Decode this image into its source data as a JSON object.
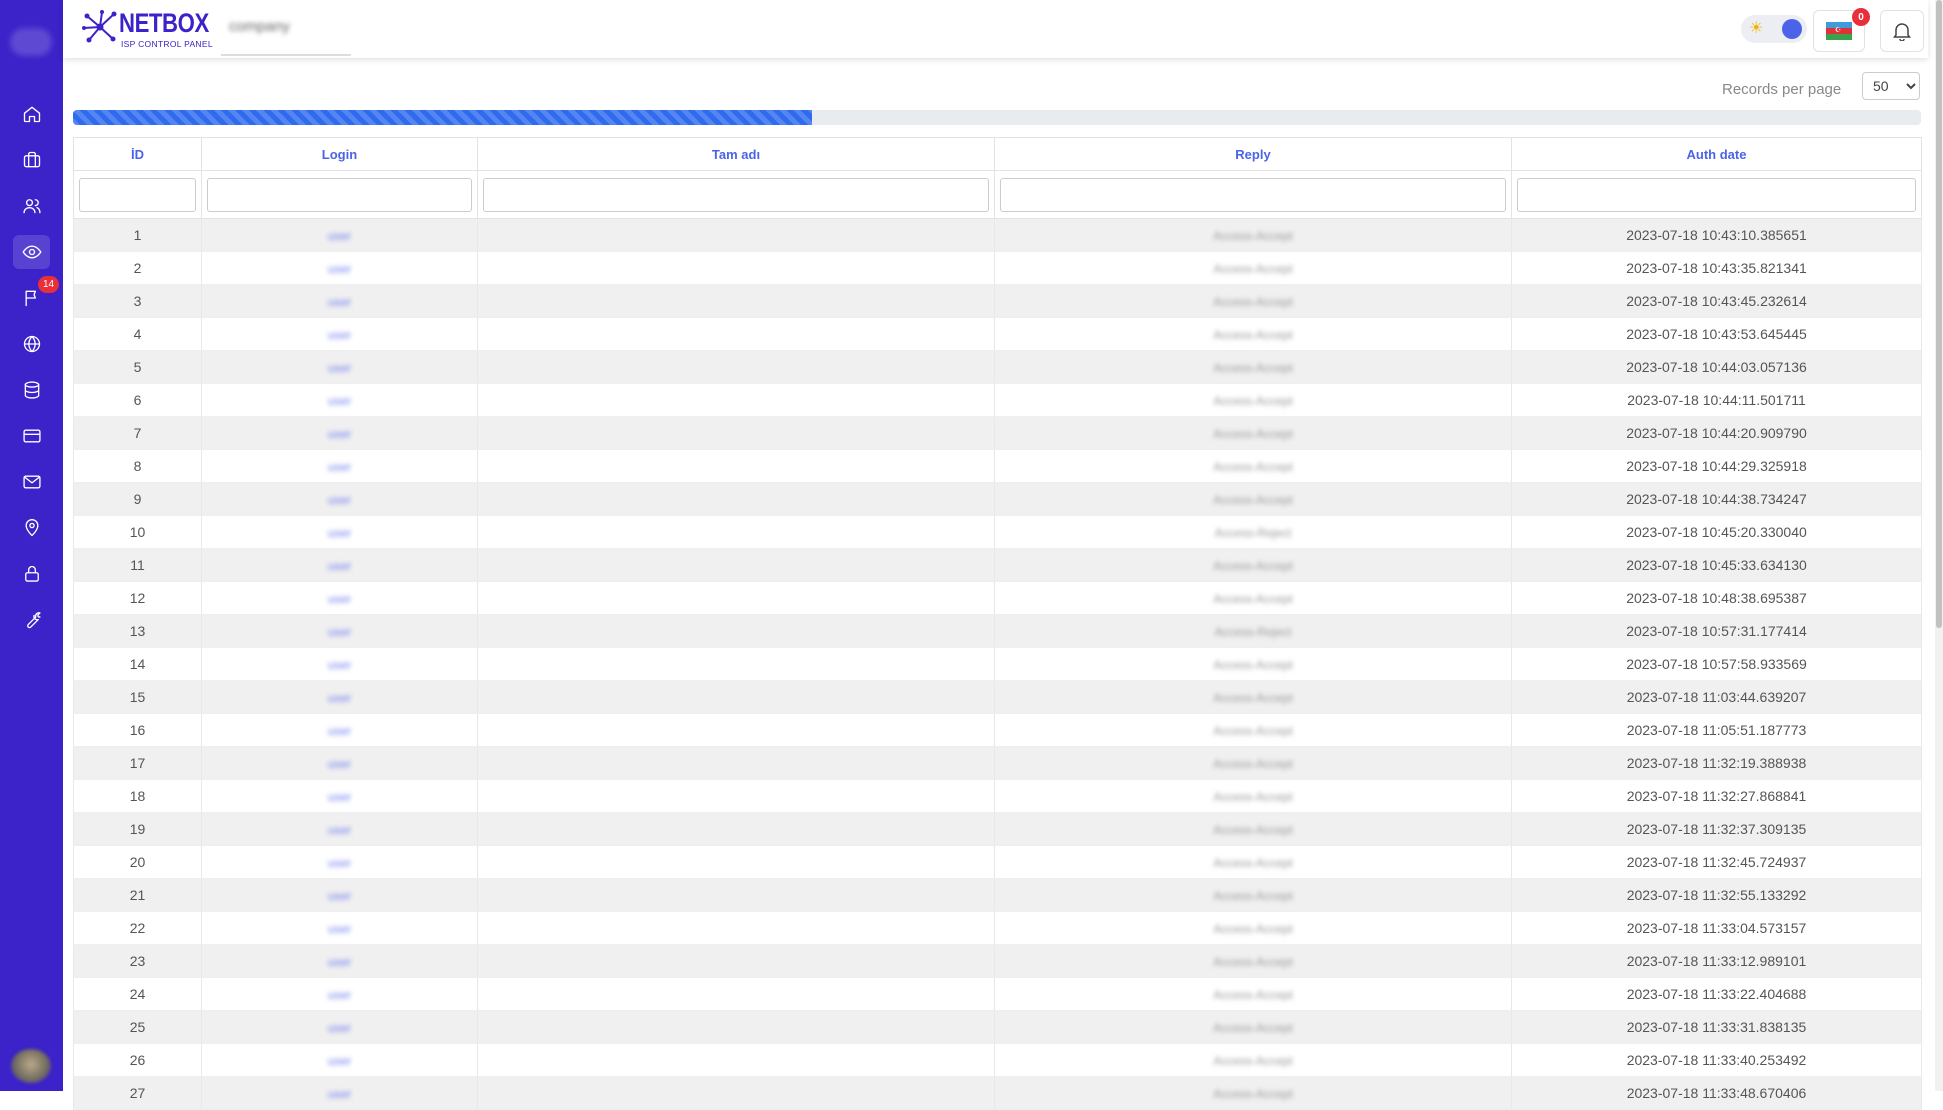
{
  "brand": {
    "name": "NETBOX",
    "subtitle": "ISP CONTROL PANEL"
  },
  "header": {
    "company_tab": "company",
    "notification_count": "0"
  },
  "sidebar": {
    "items": [
      {
        "icon": "home-icon"
      },
      {
        "icon": "briefcase-icon"
      },
      {
        "icon": "users-icon"
      },
      {
        "icon": "eye-icon",
        "active": true
      },
      {
        "icon": "flag-icon",
        "badge": "14"
      },
      {
        "icon": "globe-icon"
      },
      {
        "icon": "database-icon"
      },
      {
        "icon": "credit-card-icon"
      },
      {
        "icon": "mail-icon"
      },
      {
        "icon": "map-pin-icon"
      },
      {
        "icon": "lock-icon"
      },
      {
        "icon": "wrench-icon"
      }
    ]
  },
  "toolbar": {
    "records_per_page_label": "Records per page",
    "records_per_page_value": "50"
  },
  "progress": {
    "percent": 40
  },
  "table": {
    "columns": [
      "İD",
      "Login",
      "Tam adı",
      "Reply",
      "Auth date"
    ],
    "rows": [
      {
        "id": "1",
        "login": "user",
        "reply": "Access-Accept",
        "auth_date": "2023-07-18 10:43:10.385651"
      },
      {
        "id": "2",
        "login": "user",
        "reply": "Access-Accept",
        "auth_date": "2023-07-18 10:43:35.821341"
      },
      {
        "id": "3",
        "login": "user",
        "reply": "Access-Accept",
        "auth_date": "2023-07-18 10:43:45.232614"
      },
      {
        "id": "4",
        "login": "user",
        "reply": "Access-Accept",
        "auth_date": "2023-07-18 10:43:53.645445"
      },
      {
        "id": "5",
        "login": "user",
        "reply": "Access-Accept",
        "auth_date": "2023-07-18 10:44:03.057136"
      },
      {
        "id": "6",
        "login": "user",
        "reply": "Access-Accept",
        "auth_date": "2023-07-18 10:44:11.501711"
      },
      {
        "id": "7",
        "login": "user",
        "reply": "Access-Accept",
        "auth_date": "2023-07-18 10:44:20.909790"
      },
      {
        "id": "8",
        "login": "user",
        "reply": "Access-Accept",
        "auth_date": "2023-07-18 10:44:29.325918"
      },
      {
        "id": "9",
        "login": "user",
        "reply": "Access-Accept",
        "auth_date": "2023-07-18 10:44:38.734247"
      },
      {
        "id": "10",
        "login": "user",
        "reply": "Access-Reject",
        "auth_date": "2023-07-18 10:45:20.330040"
      },
      {
        "id": "11",
        "login": "user",
        "reply": "Access-Accept",
        "auth_date": "2023-07-18 10:45:33.634130"
      },
      {
        "id": "12",
        "login": "user",
        "reply": "Access-Accept",
        "auth_date": "2023-07-18 10:48:38.695387"
      },
      {
        "id": "13",
        "login": "user",
        "reply": "Access-Reject",
        "auth_date": "2023-07-18 10:57:31.177414"
      },
      {
        "id": "14",
        "login": "user",
        "reply": "Access-Accept",
        "auth_date": "2023-07-18 10:57:58.933569"
      },
      {
        "id": "15",
        "login": "user",
        "reply": "Access-Accept",
        "auth_date": "2023-07-18 11:03:44.639207"
      },
      {
        "id": "16",
        "login": "user",
        "reply": "Access-Accept",
        "auth_date": "2023-07-18 11:05:51.187773"
      },
      {
        "id": "17",
        "login": "user",
        "reply": "Access-Accept",
        "auth_date": "2023-07-18 11:32:19.388938"
      },
      {
        "id": "18",
        "login": "user",
        "reply": "Access-Accept",
        "auth_date": "2023-07-18 11:32:27.868841"
      },
      {
        "id": "19",
        "login": "user",
        "reply": "Access-Accept",
        "auth_date": "2023-07-18 11:32:37.309135"
      },
      {
        "id": "20",
        "login": "user",
        "reply": "Access-Accept",
        "auth_date": "2023-07-18 11:32:45.724937"
      },
      {
        "id": "21",
        "login": "user",
        "reply": "Access-Accept",
        "auth_date": "2023-07-18 11:32:55.133292"
      },
      {
        "id": "22",
        "login": "user",
        "reply": "Access-Accept",
        "auth_date": "2023-07-18 11:33:04.573157"
      },
      {
        "id": "23",
        "login": "user",
        "reply": "Access-Accept",
        "auth_date": "2023-07-18 11:33:12.989101"
      },
      {
        "id": "24",
        "login": "user",
        "reply": "Access-Accept",
        "auth_date": "2023-07-18 11:33:22.404688"
      },
      {
        "id": "25",
        "login": "user",
        "reply": "Access-Accept",
        "auth_date": "2023-07-18 11:33:31.838135"
      },
      {
        "id": "26",
        "login": "user",
        "reply": "Access-Accept",
        "auth_date": "2023-07-18 11:33:40.253492"
      },
      {
        "id": "27",
        "login": "user",
        "reply": "Access-Accept",
        "auth_date": "2023-07-18 11:33:48.670406"
      }
    ]
  },
  "colors": {
    "sidebar": "#3b22c9",
    "accent": "#4b63e8",
    "progress": "#2f6bef",
    "badge": "#e8303a"
  }
}
